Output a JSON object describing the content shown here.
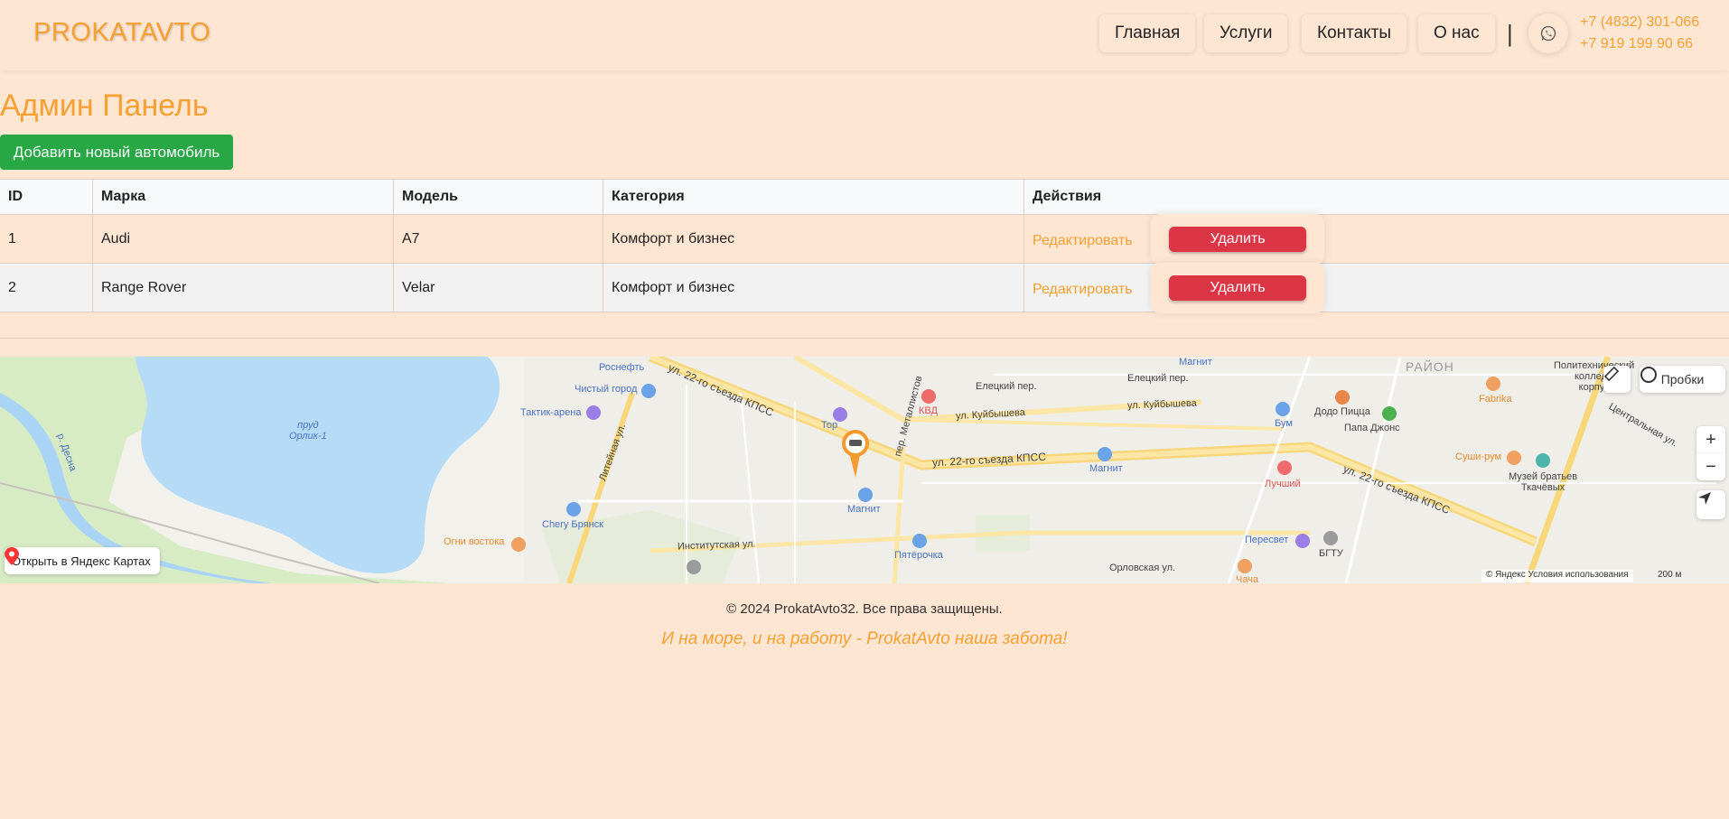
{
  "header": {
    "logo": "PROKATAVTO",
    "nav": [
      "Главная",
      "Услуги",
      "Контакты",
      "О нас"
    ],
    "separator": "|",
    "phones": [
      "+7 (4832) 301-066",
      "+7 919 199 90 66"
    ]
  },
  "page_title": "Админ Панель",
  "add_button": "Добавить новый автомобиль",
  "table": {
    "headers": [
      "ID",
      "Марка",
      "Модель",
      "Категория",
      "Действия"
    ],
    "rows": [
      {
        "id": "1",
        "brand": "Audi",
        "model": "A7",
        "category": "Комфорт и бизнес",
        "edit": "Редактировать",
        "delete": "Удалить"
      },
      {
        "id": "2",
        "brand": "Range Rover",
        "model": "Velar",
        "category": "Комфорт и бизнес",
        "edit": "Редактировать",
        "delete": "Удалить"
      }
    ]
  },
  "map": {
    "open_link": "Открыть в Яндекс Картах",
    "traffic": "Пробки",
    "zoom_in": "+",
    "zoom_out": "−",
    "copyright": "© Яндекс  Условия использования",
    "scale": "200 м",
    "labels": {
      "rosneft": "Роснефть",
      "chisty_gorod": "Чистый город",
      "taktik": "Тактик-арена",
      "pond": "пруд\nОрлик-1",
      "desna": "р. Десна",
      "chery": "Chery Брянск",
      "ogni": "Огни востока",
      "tor": "Тор",
      "kvd": "КВД",
      "magnit1": "Магнит",
      "magnit2": "Магнит",
      "magnit3": "Магнит",
      "pyaterochka": "Пятёрочка",
      "bum": "Бум",
      "luchshiy": "Лучший",
      "peresvet": "Пересвет",
      "bgtu": "БГТУ",
      "dodo": "Додо Пицца",
      "papa": "Папа Джонс",
      "sushi": "Суши-рум",
      "museum": "Музей братьев\nТкачёвых",
      "fabrika": "Fabrika",
      "rayon": "РАЙОН",
      "poly": "Политехнический\nколледж\nкорпус",
      "chacha": "Чача",
      "street_22": "ул. 22-го съезда КПСС",
      "street_kuib": "ул. Куйбышева",
      "street_inst": "Институтская ул.",
      "street_orl": "Орловская ул.",
      "street_lit": "Литейная ул.",
      "street_elets": "Елецкий пер.",
      "street_centr": "Центральная ул.",
      "street_metal": "пер. Металлистов"
    }
  },
  "footer": {
    "copyright": "© 2024 ProkatAvto32. Все права защищены.",
    "slogan": "И на море, и на работу - ProkatAvto наша забота!"
  }
}
